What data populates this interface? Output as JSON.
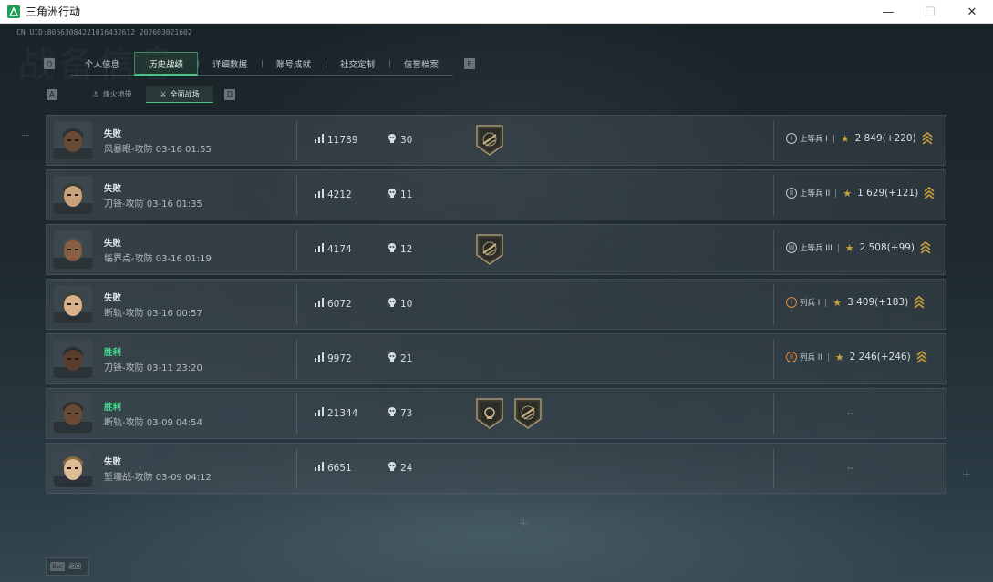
{
  "window": {
    "title": "三角洲行动",
    "minimize": "—",
    "maximize": "☐",
    "close": "✕"
  },
  "uid_text": "CN UID:80663084221016432612_202603021602",
  "watermark": "战备信息",
  "tabs": [
    {
      "label": "个人信息",
      "active": false
    },
    {
      "label": "历史战绩",
      "active": true
    },
    {
      "label": "详细数据",
      "active": false
    },
    {
      "label": "账号成就",
      "active": false
    },
    {
      "label": "社交定制",
      "active": false
    },
    {
      "label": "信誉档案",
      "active": false
    }
  ],
  "tab_keys": {
    "left": "Q",
    "right": "E"
  },
  "subtabs": [
    {
      "label": "烽火地带",
      "icon": "firezone-icon",
      "active": false
    },
    {
      "label": "全面战场",
      "icon": "battlefield-icon",
      "active": true
    }
  ],
  "subtab_keys": {
    "left": "A",
    "right": "D"
  },
  "matches": [
    {
      "result": "失败",
      "win": false,
      "map_time": "风暴眼-攻防 03-16 01:55",
      "score": "11789",
      "kills": "30",
      "badges": [
        "rifle-medal-icon"
      ],
      "rank_name": "上等兵 I",
      "rank_num": "I",
      "rank_color": "white",
      "rank_score": "2 849(+220)"
    },
    {
      "result": "失败",
      "win": false,
      "map_time": "刀锋-攻防 03-16 01:35",
      "score": "4212",
      "kills": "11",
      "badges": [],
      "rank_name": "上等兵 II",
      "rank_num": "II",
      "rank_color": "white",
      "rank_score": "1 629(+121)"
    },
    {
      "result": "失败",
      "win": false,
      "map_time": "临界点-攻防 03-16 01:19",
      "score": "4174",
      "kills": "12",
      "badges": [
        "rifle-medal-icon"
      ],
      "rank_name": "上等兵 III",
      "rank_num": "III",
      "rank_color": "white",
      "rank_score": "2 508(+99)"
    },
    {
      "result": "失败",
      "win": false,
      "map_time": "断轨-攻防 03-16 00:57",
      "score": "6072",
      "kills": "10",
      "badges": [],
      "rank_name": "列兵 I",
      "rank_num": "I",
      "rank_color": "orange",
      "rank_score": "3 409(+183)"
    },
    {
      "result": "胜利",
      "win": true,
      "map_time": "刀锋-攻防 03-11 23:20",
      "score": "9972",
      "kills": "21",
      "badges": [],
      "rank_name": "列兵 II",
      "rank_num": "II",
      "rank_color": "orange",
      "rank_score": "2 246(+246)"
    },
    {
      "result": "胜利",
      "win": true,
      "map_time": "断轨-攻防 03-09 04:54",
      "score": "21344",
      "kills": "73",
      "badges": [
        "skull-medal-icon",
        "rifle-medal-icon"
      ],
      "rank_name": "",
      "rank_score": "--"
    },
    {
      "result": "失败",
      "win": false,
      "map_time": "堑壕战-攻防 03-09 04:12",
      "score": "6651",
      "kills": "24",
      "badges": [],
      "rank_name": "",
      "rank_score": "--"
    }
  ],
  "bottom": {
    "esc_key": "Esc",
    "esc_label": "返回"
  },
  "colors": {
    "accent": "#4cc481",
    "win": "#3fdc8a",
    "gold": "#c9a23a",
    "rank_orange": "#e08a3c"
  }
}
